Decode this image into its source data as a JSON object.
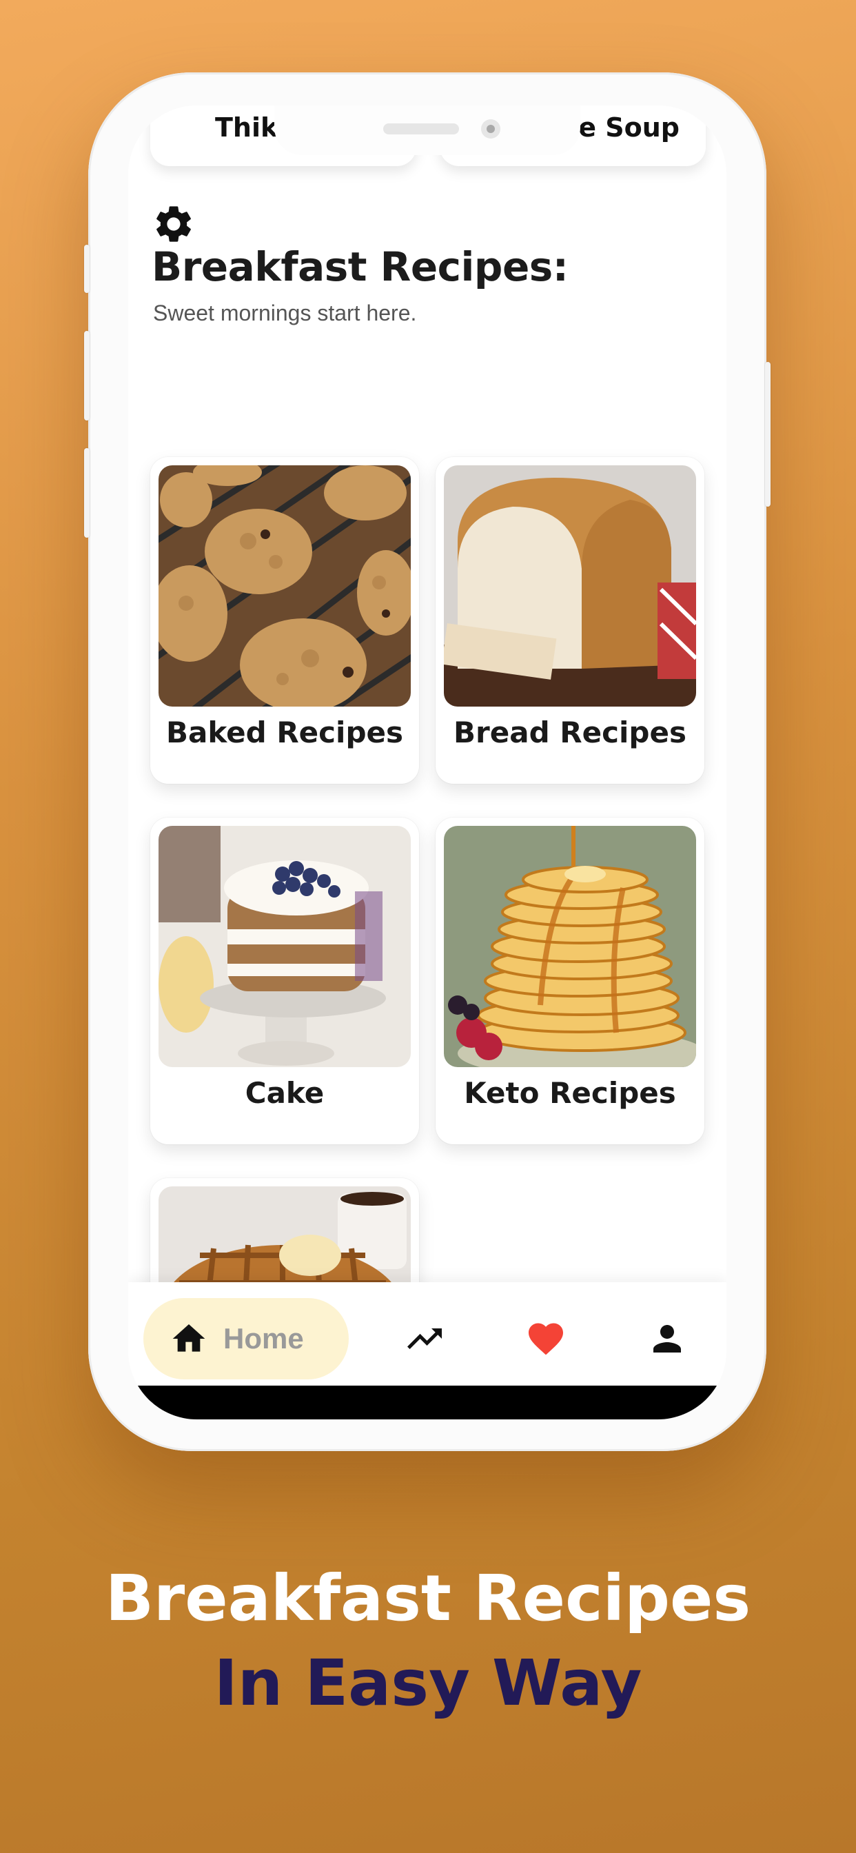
{
  "top_cards": {
    "left_title": "Thik",
    "right_title": "e Soup"
  },
  "header": {
    "settings_icon": "gear-icon",
    "title": "Breakfast Recipes:",
    "subtitle": "Sweet mornings start here."
  },
  "categories": [
    {
      "label": "Baked Recipes",
      "image": "oatmeal-cookies-on-rack"
    },
    {
      "label": "Bread Recipes",
      "image": "sliced-white-bread-loaf"
    },
    {
      "label": "Cake",
      "image": "blueberry-layer-cake"
    },
    {
      "label": "Keto Recipes",
      "image": "pancake-stack-with-syrup"
    },
    {
      "label": "",
      "image": "waffles-with-butter"
    }
  ],
  "bottom_nav": {
    "home_label": "Home",
    "items": [
      "home-icon",
      "trending-icon",
      "heart-icon",
      "profile-icon"
    ],
    "active_bg": "#fdf3d1",
    "heart_color": "#f44336"
  },
  "promo": {
    "line1": "Breakfast Recipes",
    "line2": "In Easy Way",
    "line1_color": "#ffffff",
    "line2_color": "#221a57"
  }
}
